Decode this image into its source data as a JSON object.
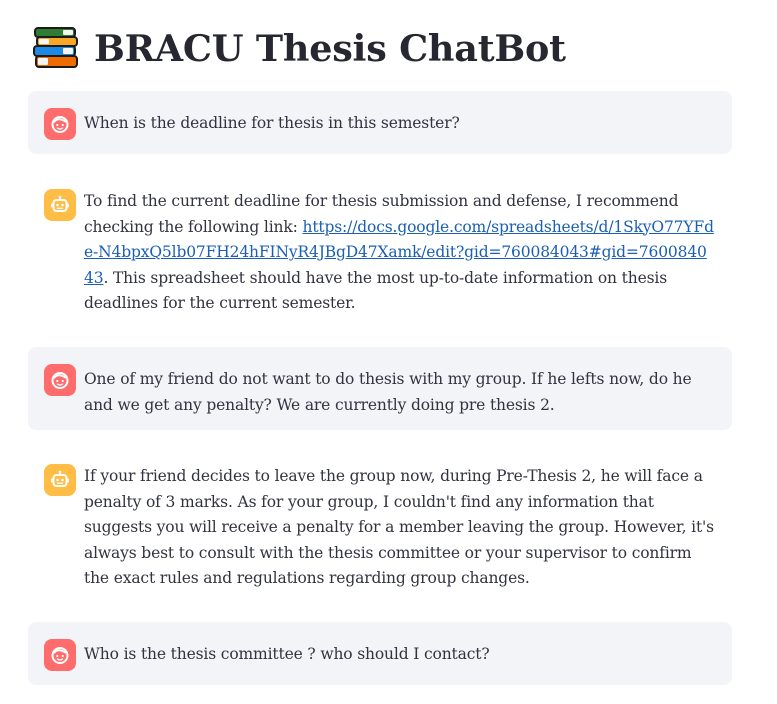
{
  "app": {
    "title": "BRACU Thesis ChatBot",
    "title_icon": "books-icon"
  },
  "colors": {
    "user_avatar": "#ff6c6c",
    "assistant_avatar": "#ffbd45",
    "user_bubble_bg": "#f0f2f6",
    "link": "#1a5fb4",
    "text": "#31333f"
  },
  "messages": [
    {
      "role": "user",
      "avatar_icon": "user-face-icon",
      "text": "When is the deadline for thesis in this semester?"
    },
    {
      "role": "assistant",
      "avatar_icon": "robot-icon",
      "text_before": "To find the current deadline for thesis submission and defense, I recommend checking the following link: ",
      "link_text": "https://docs.google.com/spreadsheets/d/1SkyO77YFde-N4bpxQ5lb07FH24hFINyR4JBgD47Xamk/edit?gid=760084043#gid=760084043",
      "text_after": ". This spreadsheet should have the most up-to-date information on thesis deadlines for the current semester."
    },
    {
      "role": "user",
      "avatar_icon": "user-face-icon",
      "text": "One of my friend do not want to do thesis with my group. If he lefts now, do he and we get any penalty? We are currently doing pre thesis 2."
    },
    {
      "role": "assistant",
      "avatar_icon": "robot-icon",
      "text": "If your friend decides to leave the group now, during Pre-Thesis 2, he will face a penalty of 3 marks. As for your group, I couldn't find any information that suggests you will receive a penalty for a member leaving the group. However, it's always best to consult with the thesis committee or your supervisor to confirm the exact rules and regulations regarding group changes."
    },
    {
      "role": "user",
      "avatar_icon": "user-face-icon",
      "text": "Who is the thesis committee ? who should I contact?"
    }
  ]
}
